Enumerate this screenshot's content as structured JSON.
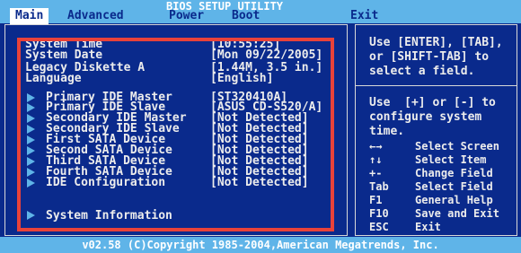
{
  "header": {
    "title": "BIOS SETUP UTILITY",
    "tabs": [
      {
        "label": "Main"
      },
      {
        "label": "Advanced"
      },
      {
        "label": "Power"
      },
      {
        "label": "Boot"
      },
      {
        "label": "Exit"
      }
    ]
  },
  "main": {
    "system_time": {
      "label": "System Time",
      "value": "[10:55:25]"
    },
    "system_date": {
      "label": "System Date",
      "value": "[Mon 09/22/2005]"
    },
    "legacy_diskette": {
      "label": "Legacy Diskette A",
      "value": "[1.44M, 3.5 in.]"
    },
    "language": {
      "label": "Language",
      "value": "[English]"
    },
    "devices": [
      {
        "label": "Primary IDE Master",
        "value": "[ST320410A]"
      },
      {
        "label": "Primary IDE Slave",
        "value": "[ASUS CD-S520/A]"
      },
      {
        "label": "Secondary IDE Master",
        "value": "[Not Detected]"
      },
      {
        "label": "Secondary IDE Slave",
        "value": "[Not Detected]"
      },
      {
        "label": "First SATA Device",
        "value": "[Not Detected]"
      },
      {
        "label": "Second SATA Device",
        "value": "[Not Detected]"
      },
      {
        "label": "Third SATA Device",
        "value": "[Not Detected]"
      },
      {
        "label": "Fourth SATA Device",
        "value": "[Not Detected]"
      },
      {
        "label": "IDE Configuration",
        "value": "[Not Detected]"
      }
    ],
    "system_information": {
      "label": "System Information"
    }
  },
  "help": {
    "line1": "Use [ENTER], [TAB],",
    "line2": "or [SHIFT-TAB] to",
    "line3": "select a field.",
    "line4": "Use  [+] or [-] to",
    "line5": "configure system",
    "line6": "time."
  },
  "keys": [
    {
      "key": "←→",
      "desc": "Select Screen"
    },
    {
      "key": "↑↓",
      "desc": "Select Item"
    },
    {
      "key": "+-",
      "desc": "Change Field"
    },
    {
      "key": "Tab",
      "desc": "Select Field"
    },
    {
      "key": "F1",
      "desc": "General Help"
    },
    {
      "key": "F10",
      "desc": "Save and Exit"
    },
    {
      "key": "ESC",
      "desc": "Exit"
    }
  ],
  "footer": {
    "text": "v02.58 (C)Copyright 1985-2004,American Megatrends, Inc."
  },
  "colors": {
    "background": "#0a2a8c",
    "bar": "#5fb4e8",
    "highlight_frame": "#e8423a",
    "text": "#ececec"
  }
}
